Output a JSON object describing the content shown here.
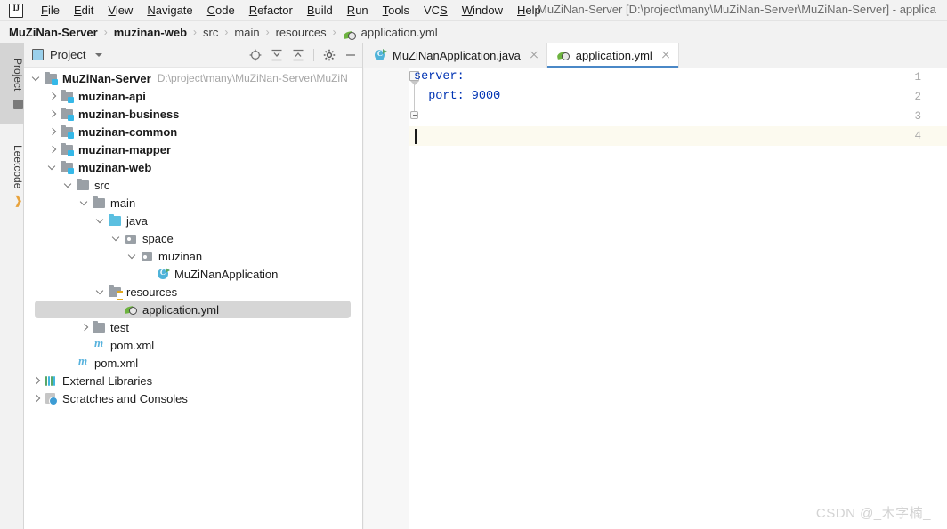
{
  "window": {
    "title": "MuZiNan-Server [D:\\project\\many\\MuZiNan-Server\\MuZiNan-Server] - applica",
    "logo": "intellij-idea-logo"
  },
  "menu": {
    "items": [
      {
        "label": "File",
        "mnemonic": "F"
      },
      {
        "label": "Edit",
        "mnemonic": "E"
      },
      {
        "label": "View",
        "mnemonic": "V"
      },
      {
        "label": "Navigate",
        "mnemonic": "N"
      },
      {
        "label": "Code",
        "mnemonic": "C"
      },
      {
        "label": "Refactor",
        "mnemonic": "R"
      },
      {
        "label": "Build",
        "mnemonic": "B"
      },
      {
        "label": "Run",
        "mnemonic": "R"
      },
      {
        "label": "Tools",
        "mnemonic": "T"
      },
      {
        "label": "VCS",
        "mnemonic": "S"
      },
      {
        "label": "Window",
        "mnemonic": "W"
      },
      {
        "label": "Help",
        "mnemonic": "H"
      }
    ]
  },
  "breadcrumb": {
    "separator": "›",
    "items": [
      {
        "label": "MuZiNan-Server",
        "bold": true
      },
      {
        "label": "muzinan-web",
        "bold": true
      },
      {
        "label": "src",
        "bold": false
      },
      {
        "label": "main",
        "bold": false
      },
      {
        "label": "resources",
        "bold": false
      },
      {
        "label": "application.yml",
        "bold": false,
        "icon": "spring-yaml-icon"
      }
    ]
  },
  "toolstrip": {
    "tabs": [
      {
        "label": "Project",
        "icon": "project-icon",
        "active": true
      },
      {
        "label": "Leetcode",
        "icon": "leetcode-icon",
        "active": false
      }
    ]
  },
  "project_panel": {
    "title": "Project",
    "view_dropdown_icon": "chevron-down-icon",
    "actions": [
      {
        "name": "select-opened-file-icon",
        "title": "Select Opened File"
      },
      {
        "name": "expand-all-icon",
        "title": "Expand All"
      },
      {
        "name": "collapse-all-icon",
        "title": "Collapse All"
      },
      {
        "name": "settings-gear-icon",
        "title": "Settings"
      },
      {
        "name": "hide-icon",
        "title": "Hide"
      }
    ],
    "tree": [
      {
        "label": "MuZiNan-Server",
        "hint": "D:\\project\\many\\MuZiNan-Server\\MuZiN",
        "depth": 0,
        "arrow": "down",
        "icon": "module-folder-icon",
        "bold": true,
        "selected": false
      },
      {
        "label": "muzinan-api",
        "hint": "",
        "depth": 1,
        "arrow": "right",
        "icon": "module-folder-icon",
        "bold": true,
        "selected": false
      },
      {
        "label": "muzinan-business",
        "hint": "",
        "depth": 1,
        "arrow": "right",
        "icon": "module-folder-icon",
        "bold": true,
        "selected": false
      },
      {
        "label": "muzinan-common",
        "hint": "",
        "depth": 1,
        "arrow": "right",
        "icon": "module-folder-icon",
        "bold": true,
        "selected": false
      },
      {
        "label": "muzinan-mapper",
        "hint": "",
        "depth": 1,
        "arrow": "right",
        "icon": "module-folder-icon",
        "bold": true,
        "selected": false
      },
      {
        "label": "muzinan-web",
        "hint": "",
        "depth": 1,
        "arrow": "down",
        "icon": "module-folder-icon",
        "bold": true,
        "selected": false
      },
      {
        "label": "src",
        "hint": "",
        "depth": 2,
        "arrow": "down",
        "icon": "folder-icon",
        "bold": false,
        "selected": false
      },
      {
        "label": "main",
        "hint": "",
        "depth": 3,
        "arrow": "down",
        "icon": "folder-icon",
        "bold": false,
        "selected": false
      },
      {
        "label": "java",
        "hint": "",
        "depth": 4,
        "arrow": "down",
        "icon": "source-root-icon",
        "bold": false,
        "selected": false
      },
      {
        "label": "space",
        "hint": "",
        "depth": 5,
        "arrow": "down",
        "icon": "package-icon",
        "bold": false,
        "selected": false
      },
      {
        "label": "muzinan",
        "hint": "",
        "depth": 6,
        "arrow": "down",
        "icon": "package-icon",
        "bold": false,
        "selected": false
      },
      {
        "label": "MuZiNanApplication",
        "hint": "",
        "depth": 7,
        "arrow": "none",
        "icon": "java-class-runnable-icon",
        "bold": false,
        "selected": false
      },
      {
        "label": "resources",
        "hint": "",
        "depth": 4,
        "arrow": "down",
        "icon": "resources-root-icon",
        "bold": false,
        "selected": false
      },
      {
        "label": "application.yml",
        "hint": "",
        "depth": 5,
        "arrow": "none",
        "icon": "spring-yaml-icon",
        "bold": false,
        "selected": true
      },
      {
        "label": "test",
        "hint": "",
        "depth": 3,
        "arrow": "right",
        "icon": "folder-icon",
        "bold": false,
        "selected": false
      },
      {
        "label": "pom.xml",
        "hint": "",
        "depth": 3,
        "arrow": "none",
        "icon": "maven-icon",
        "bold": false,
        "selected": false
      },
      {
        "label": "pom.xml",
        "hint": "",
        "depth": 2,
        "arrow": "none",
        "icon": "maven-icon",
        "bold": false,
        "selected": false
      },
      {
        "label": "External Libraries",
        "hint": "",
        "depth": 0,
        "arrow": "right",
        "icon": "external-libraries-icon",
        "bold": false,
        "selected": false
      },
      {
        "label": "Scratches and Consoles",
        "hint": "",
        "depth": 0,
        "arrow": "right",
        "icon": "scratches-icon",
        "bold": false,
        "selected": false
      }
    ]
  },
  "editor": {
    "tabs": [
      {
        "label": "MuZiNanApplication.java",
        "icon": "java-class-runnable-icon",
        "active": false
      },
      {
        "label": "application.yml",
        "icon": "spring-yaml-icon",
        "active": true
      }
    ],
    "line_numbers": [
      "1",
      "2",
      "3",
      "4"
    ],
    "lines": [
      {
        "number": "1",
        "text": "server:",
        "indent": 0
      },
      {
        "number": "2",
        "text": "  port: 9000",
        "indent": 0
      },
      {
        "number": "3",
        "text": "",
        "indent": 0
      },
      {
        "number": "4",
        "text": "",
        "indent": 0
      }
    ],
    "caret_line": 4,
    "highlight_color": "#fcfaef",
    "code_color": "#0033b3"
  },
  "watermark": {
    "text": "CSDN @_木字楠_"
  }
}
